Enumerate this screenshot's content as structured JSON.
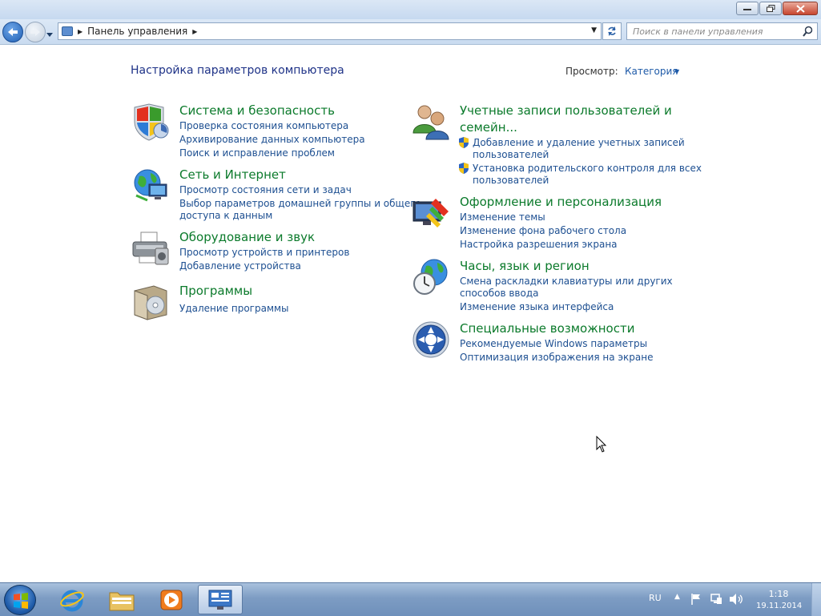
{
  "window": {
    "minimize_icon": "minimize-icon",
    "maximize_icon": "restore-icon",
    "close_icon": "close-icon"
  },
  "address": {
    "crumb": "Панель управления",
    "search_placeholder": "Поиск в панели управления"
  },
  "header": {
    "title": "Настройка параметров компьютера",
    "view_label": "Просмотр:",
    "view_value": "Категория"
  },
  "left_categories": [
    {
      "title": "Система и безопасность",
      "links": [
        "Проверка состояния компьютера",
        "Архивирование данных компьютера",
        "Поиск и исправление проблем"
      ]
    },
    {
      "title": "Сеть и Интернет",
      "links": [
        "Просмотр состояния сети и задач",
        "Выбор параметров домашней группы и общего",
        "доступа к данным"
      ]
    },
    {
      "title": "Оборудование и звук",
      "links": [
        "Просмотр устройств и принтеров",
        "Добавление устройства"
      ]
    },
    {
      "title": "Программы",
      "links": [
        "Удаление программы"
      ]
    }
  ],
  "right_categories": [
    {
      "title_line1": "Учетные записи пользователей и",
      "title_line2": "семейн...",
      "links": [
        "Добавление и удаление учетных записей",
        "пользователей",
        "Установка родительского контроля для всех",
        "пользователей"
      ]
    },
    {
      "title": "Оформление и персонализация",
      "links": [
        "Изменение темы",
        "Изменение фона рабочего стола",
        "Настройка разрешения экрана"
      ]
    },
    {
      "title": "Часы, язык и регион",
      "links": [
        "Смена раскладки клавиатуры или других",
        "способов ввода",
        "Изменение языка интерфейса"
      ]
    },
    {
      "title": "Специальные возможности",
      "links": [
        "Рекомендуемые Windows параметры",
        "Оптимизация изображения на экране"
      ]
    }
  ],
  "taskbar": {
    "lang": "RU",
    "time": "1:18",
    "date": "19.11.2014",
    "items": [
      "internet-explorer-icon",
      "explorer-folder-icon",
      "media-player-icon",
      "control-panel-icon"
    ]
  },
  "colors": {
    "category_title": "#0b7a2b",
    "link": "#1d4f91",
    "page_title": "#1e3287"
  }
}
